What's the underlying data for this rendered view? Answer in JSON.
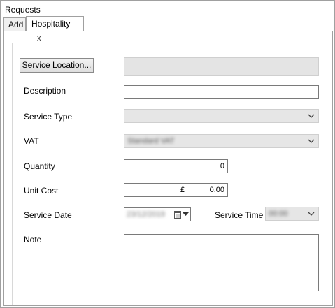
{
  "group": {
    "title": "Requests"
  },
  "tabs": [
    {
      "label": "Add"
    },
    {
      "label": "Hospitality",
      "close": "x"
    }
  ],
  "form": {
    "service_location_button": "Service Location...",
    "service_location_value": "",
    "description_label": "Description",
    "description_value": "",
    "service_type_label": "Service Type",
    "service_type_value": "",
    "vat_label": "VAT",
    "vat_value": "Standard VAT",
    "quantity_label": "Quantity",
    "quantity_value": "0",
    "unit_cost_label": "Unit Cost",
    "unit_cost_currency": "£",
    "unit_cost_value": "0.00",
    "service_date_label": "Service Date",
    "service_date_value": "23/12/2019",
    "service_time_label": "Service Time",
    "service_time_value": "00:00",
    "note_label": "Note",
    "note_value": ""
  },
  "icons": {
    "dropdown": "chevron-down-icon",
    "calendar": "calendar-icon",
    "close": "close-icon"
  }
}
